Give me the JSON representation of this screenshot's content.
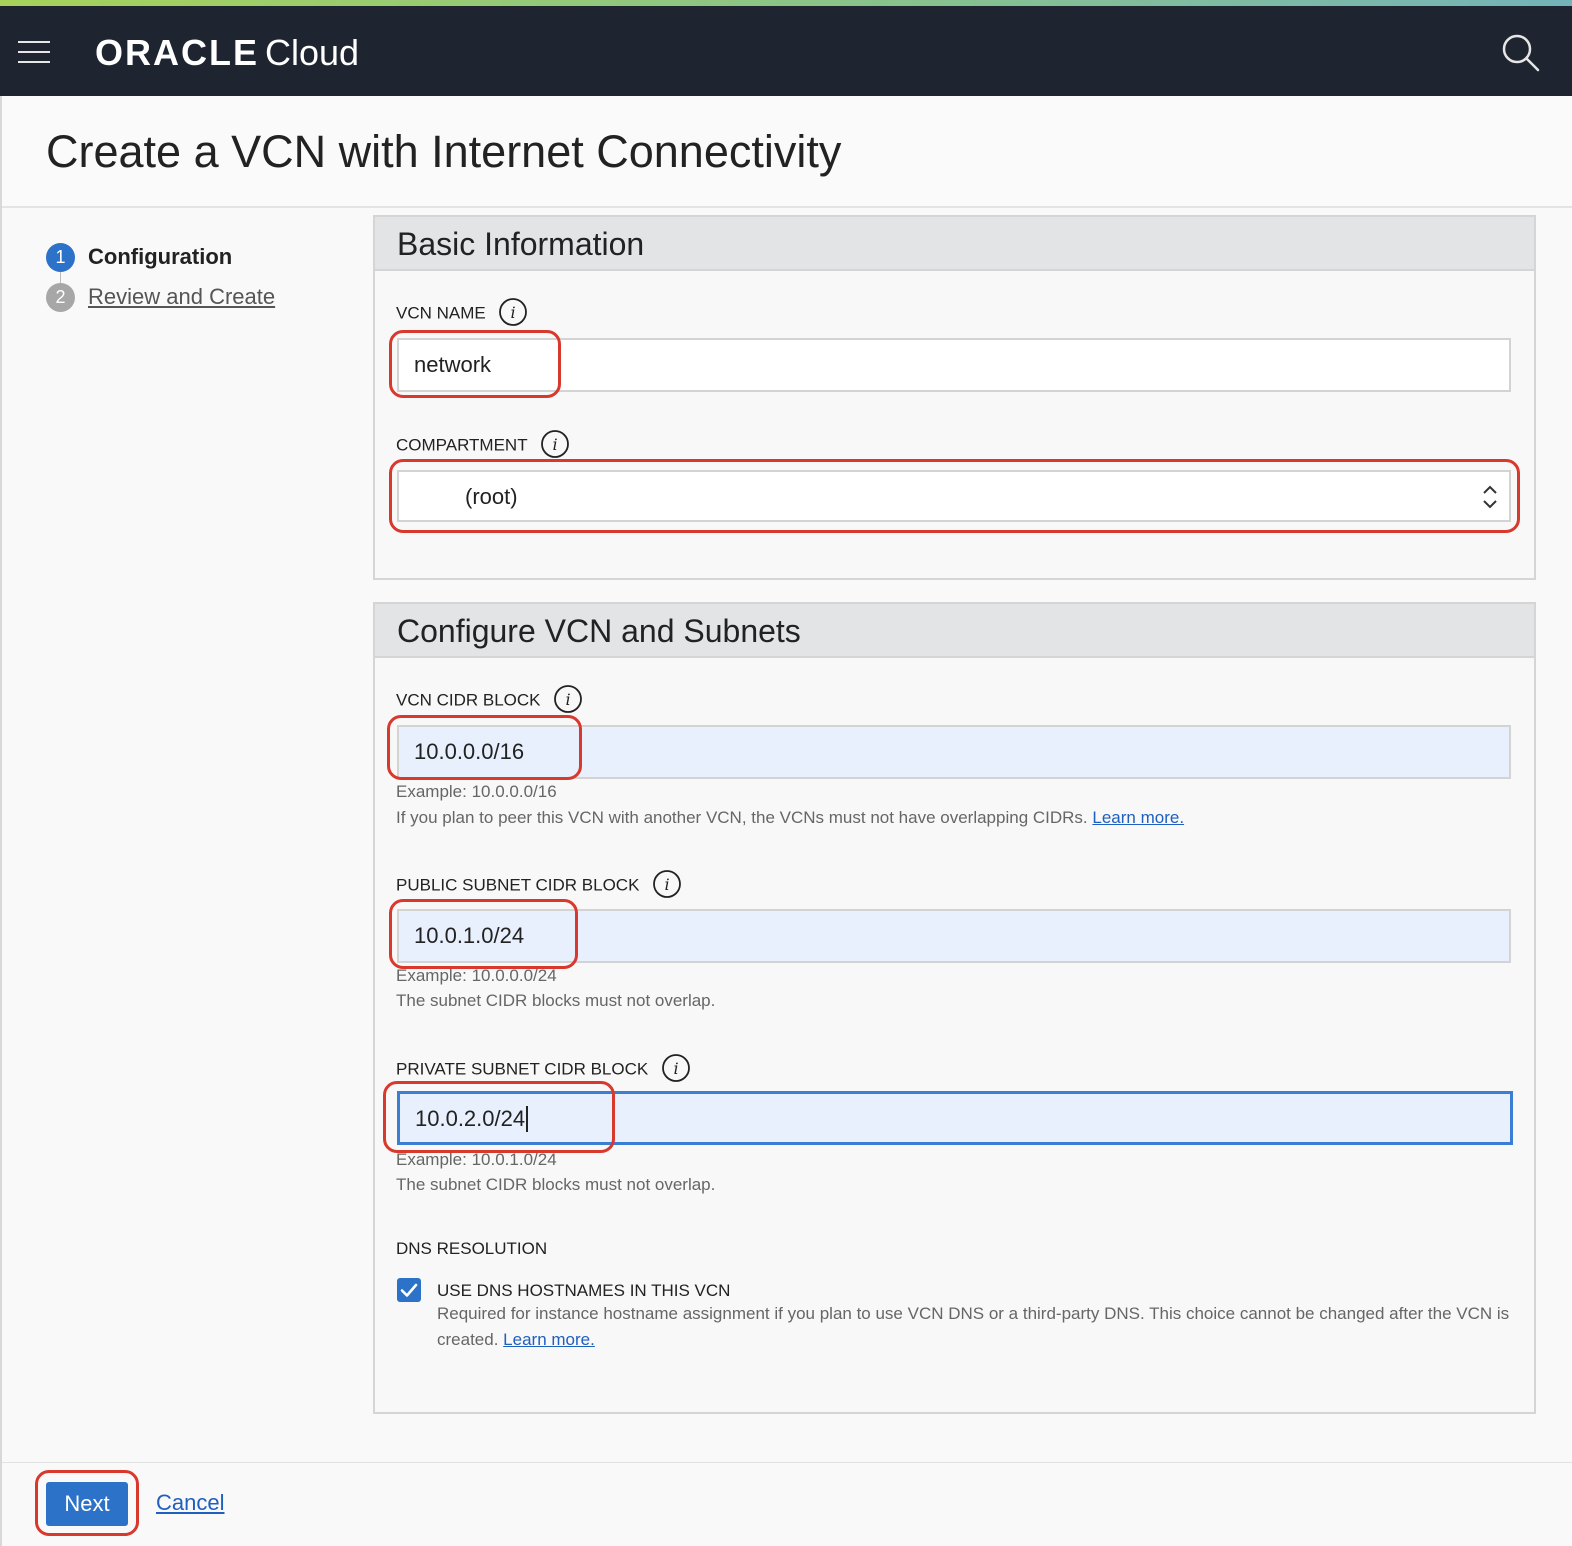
{
  "header": {
    "brand_logo": "ORACLE",
    "brand_product": "Cloud",
    "menu_icon": "hamburger-menu-icon",
    "search_icon": "search-icon"
  },
  "page": {
    "title": "Create a VCN with Internet Connectivity"
  },
  "steps": [
    {
      "number": "1",
      "label": "Configuration",
      "active": true
    },
    {
      "number": "2",
      "label": "Review and Create",
      "active": false
    }
  ],
  "basic_information": {
    "heading": "Basic Information",
    "vcn_name": {
      "label": "VCN NAME",
      "value": "network"
    },
    "compartment": {
      "label": "COMPARTMENT",
      "value": "(root)"
    }
  },
  "configure_vcn": {
    "heading": "Configure VCN and Subnets",
    "vcn_cidr": {
      "label": "VCN CIDR BLOCK",
      "value": "10.0.0.0/16",
      "example": "Example: 10.0.0.0/16",
      "note": "If you plan to peer this VCN with another VCN, the VCNs must not have overlapping CIDRs.",
      "link": "Learn more."
    },
    "public_subnet": {
      "label": "PUBLIC SUBNET CIDR BLOCK",
      "value": "10.0.1.0/24",
      "example": "Example: 10.0.0.0/24",
      "note": "The subnet CIDR blocks must not overlap."
    },
    "private_subnet": {
      "label": "PRIVATE SUBNET CIDR BLOCK",
      "value": "10.0.2.0/24",
      "example": "Example: 10.0.1.0/24",
      "note": "The subnet CIDR blocks must not overlap."
    },
    "dns": {
      "label": "DNS RESOLUTION",
      "checkbox_label": "USE DNS HOSTNAMES IN THIS VCN",
      "checked": true,
      "description": "Required for instance hostname assignment if you plan to use VCN DNS or a third-party DNS. This choice cannot be changed after the VCN is created.",
      "link": "Learn more."
    }
  },
  "footer": {
    "next_label": "Next",
    "cancel_label": "Cancel"
  },
  "colors": {
    "topbar": "#1f2530",
    "primary": "#2d72c9",
    "annotation": "#d9392d",
    "input_highlight": "#e8f0fe"
  }
}
